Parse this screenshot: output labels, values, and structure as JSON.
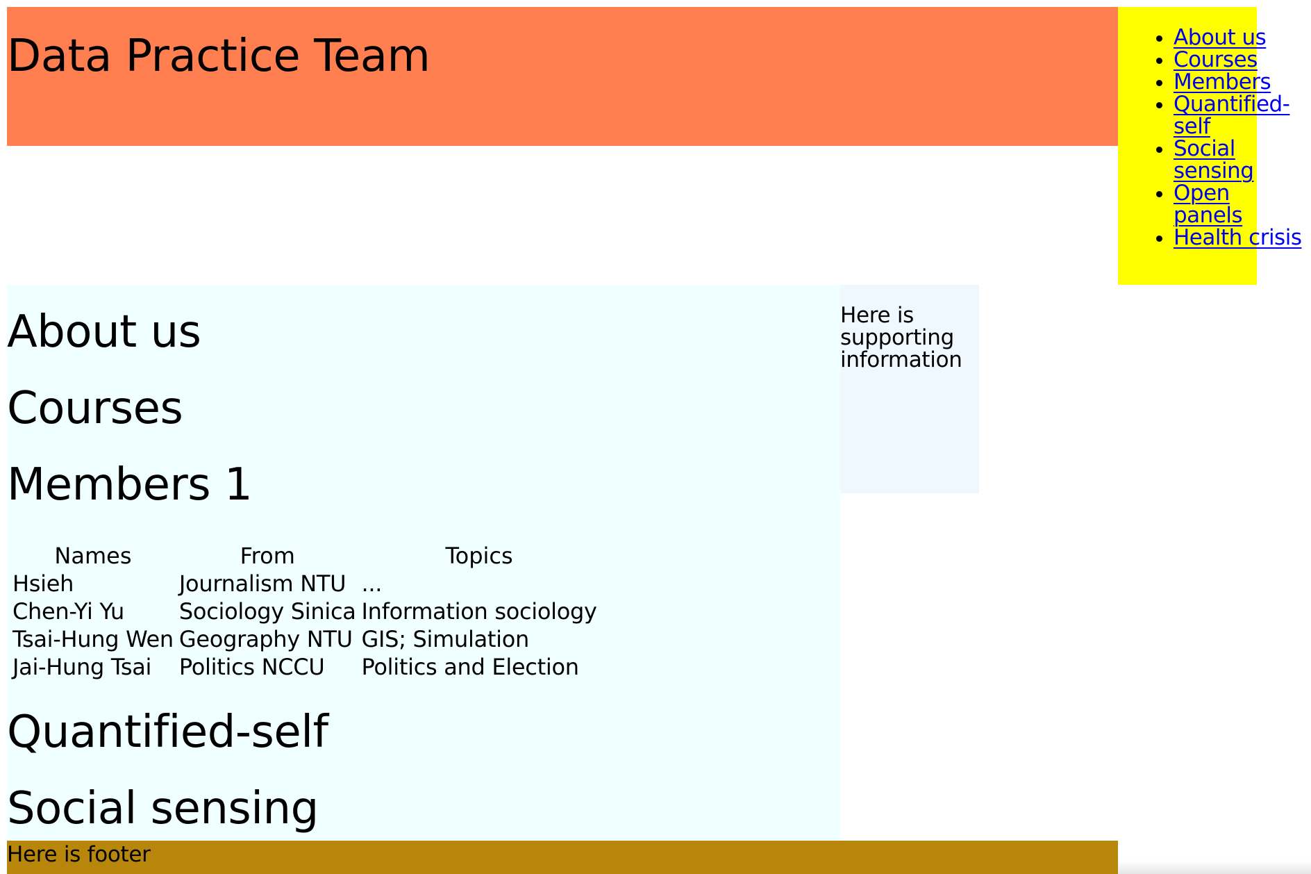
{
  "header": {
    "title": "Data Practice Team"
  },
  "nav": {
    "items": [
      {
        "label": "About us"
      },
      {
        "label": "Courses"
      },
      {
        "label": "Members"
      },
      {
        "label": "Quantified-self"
      },
      {
        "label": "Social sensing"
      },
      {
        "label": "Open panels"
      },
      {
        "label": "Health crisis"
      }
    ]
  },
  "main": {
    "about_heading": "About us",
    "courses_heading": "Courses",
    "members_heading": "Members 1",
    "quantified_heading": "Quantified-self",
    "social_heading": "Social sensing",
    "table": {
      "headers": [
        "Names",
        "From",
        "Topics"
      ],
      "rows": [
        [
          "Hsieh",
          "Journalism NTU",
          "..."
        ],
        [
          "Chen-Yi Yu",
          "Sociology Sinica",
          "Information sociology"
        ],
        [
          "Tsai-Hung Wen",
          "Geography NTU",
          "GIS; Simulation"
        ],
        [
          "Jai-Hung Tsai",
          "Politics NCCU",
          "Politics and Election"
        ]
      ]
    }
  },
  "aside": {
    "text": "Here is supporting information"
  },
  "footer": {
    "text": "Here is footer"
  },
  "colors": {
    "header_bg": "#FF7F50",
    "nav_bg": "#FFFF00",
    "main_bg": "#F0FFFF",
    "aside_bg": "#F0F8FF",
    "footer_bg": "#B8860B",
    "link": "#0000EE"
  }
}
